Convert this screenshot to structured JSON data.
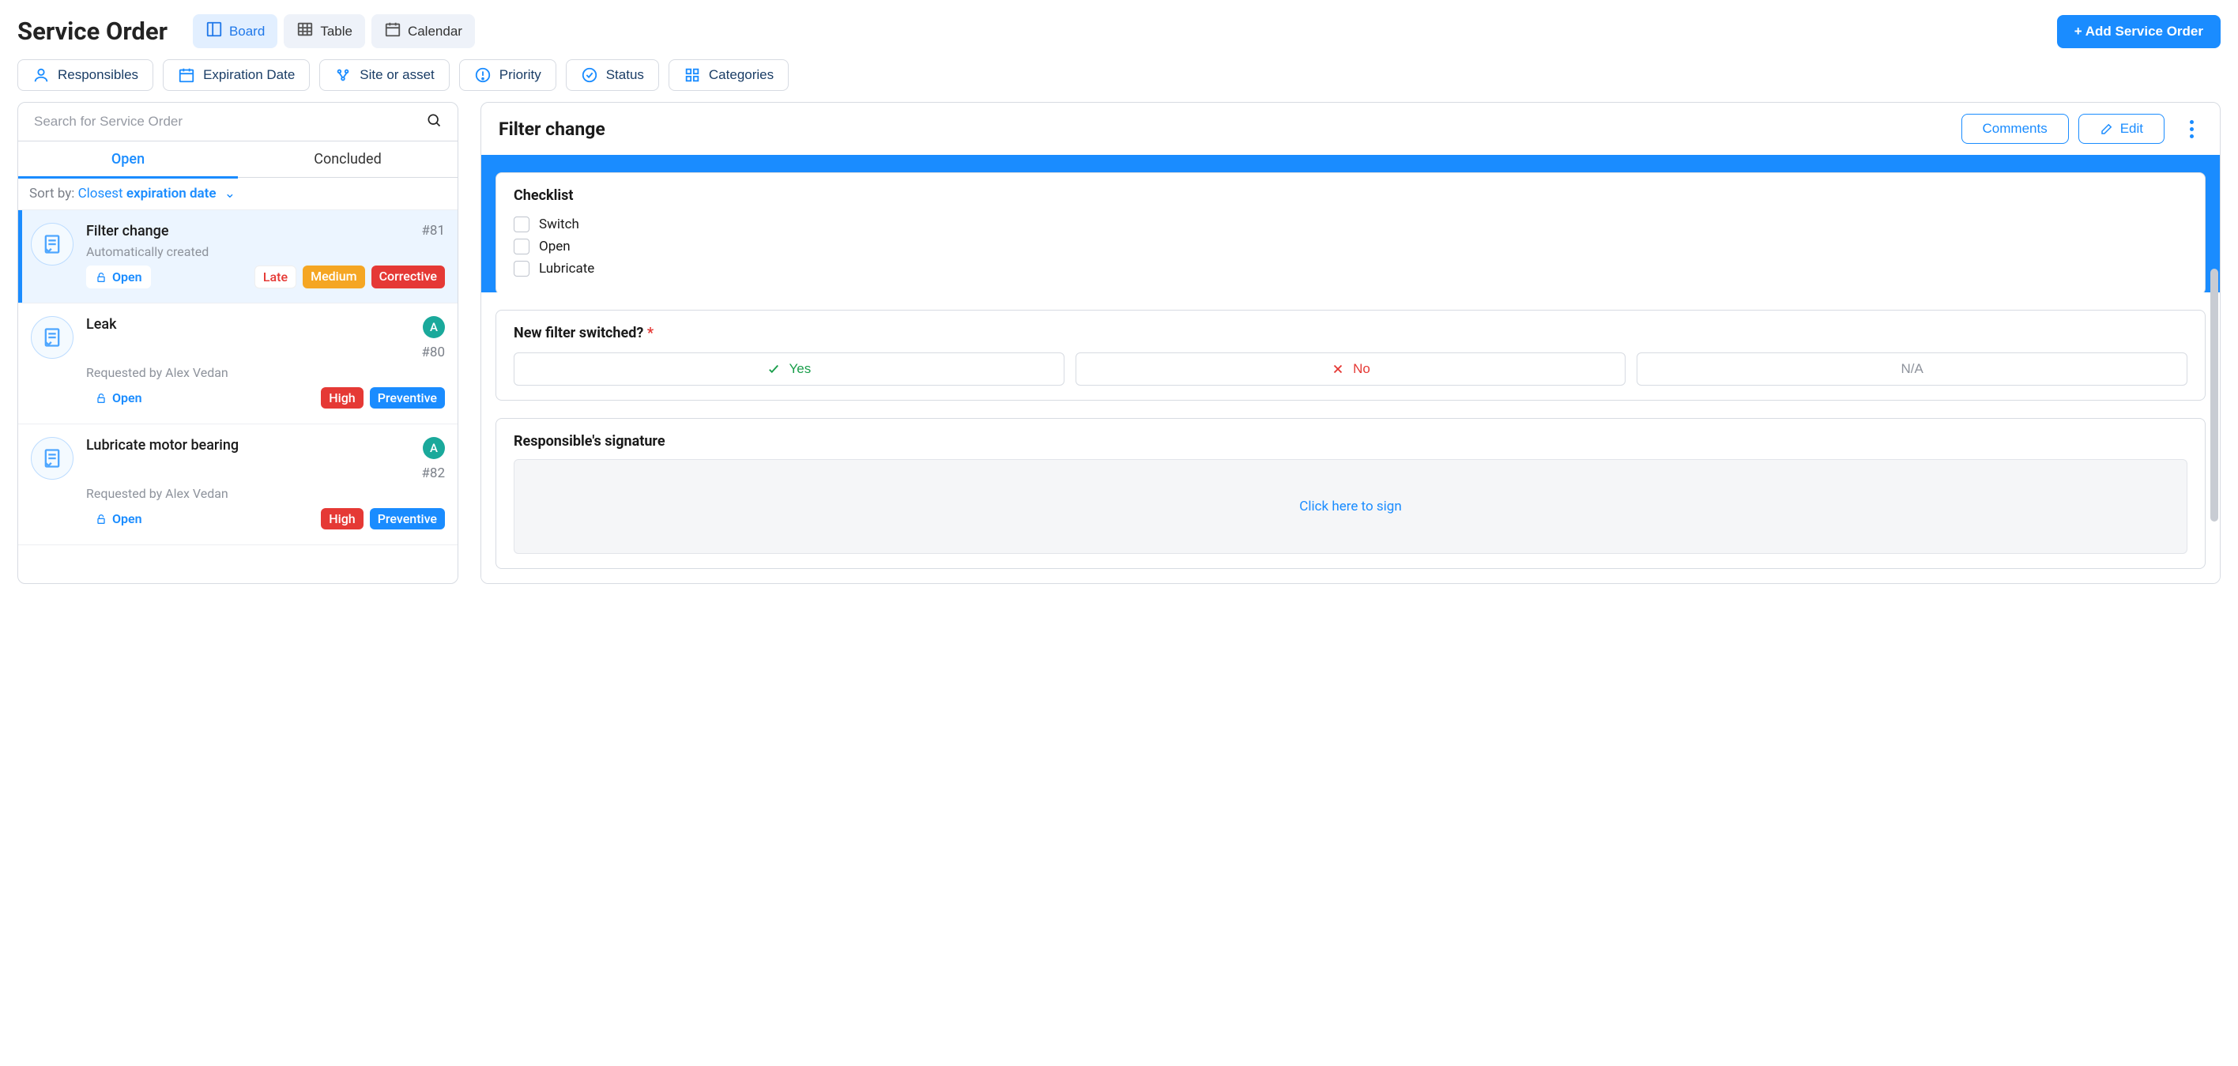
{
  "header": {
    "title": "Service Order",
    "views": {
      "board": "Board",
      "table": "Table",
      "calendar": "Calendar"
    },
    "add_btn": "+ Add Service Order"
  },
  "filters": {
    "responsibles": "Responsibles",
    "expiration": "Expiration Date",
    "site": "Site or asset",
    "priority": "Priority",
    "status": "Status",
    "categories": "Categories"
  },
  "left": {
    "search_placeholder": "Search for Service Order",
    "tabs": {
      "open": "Open",
      "concluded": "Concluded"
    },
    "sort_prefix": "Sort by:",
    "sort_a": "Closest",
    "sort_b": "expiration date",
    "status_open": "Open",
    "cards": [
      {
        "title": "Filter change",
        "sub": "Automatically created",
        "id": "#81",
        "badges": [
          {
            "cls": "late",
            "text": "Late"
          },
          {
            "cls": "medium",
            "text": "Medium"
          },
          {
            "cls": "corrective",
            "text": "Corrective"
          }
        ],
        "avatar": ""
      },
      {
        "title": "Leak",
        "sub": "Requested by Alex Vedan",
        "id": "#80",
        "badges": [
          {
            "cls": "high",
            "text": "High"
          },
          {
            "cls": "preventive",
            "text": "Preventive"
          }
        ],
        "avatar": "A"
      },
      {
        "title": "Lubricate motor bearing",
        "sub": "Requested by Alex Vedan",
        "id": "#82",
        "badges": [
          {
            "cls": "high",
            "text": "High"
          },
          {
            "cls": "preventive",
            "text": "Preventive"
          }
        ],
        "avatar": "A"
      }
    ]
  },
  "detail": {
    "title": "Filter change",
    "comments_btn": "Comments",
    "edit_btn": "Edit",
    "checklist_title": "Checklist",
    "checklist_items": [
      "Switch",
      "Open",
      "Lubricate"
    ],
    "question": "New filter switched?",
    "opt_yes": "Yes",
    "opt_no": "No",
    "opt_na": "N/A",
    "signature_title": "Responsible's signature",
    "sign_cta": "Click here to sign"
  }
}
